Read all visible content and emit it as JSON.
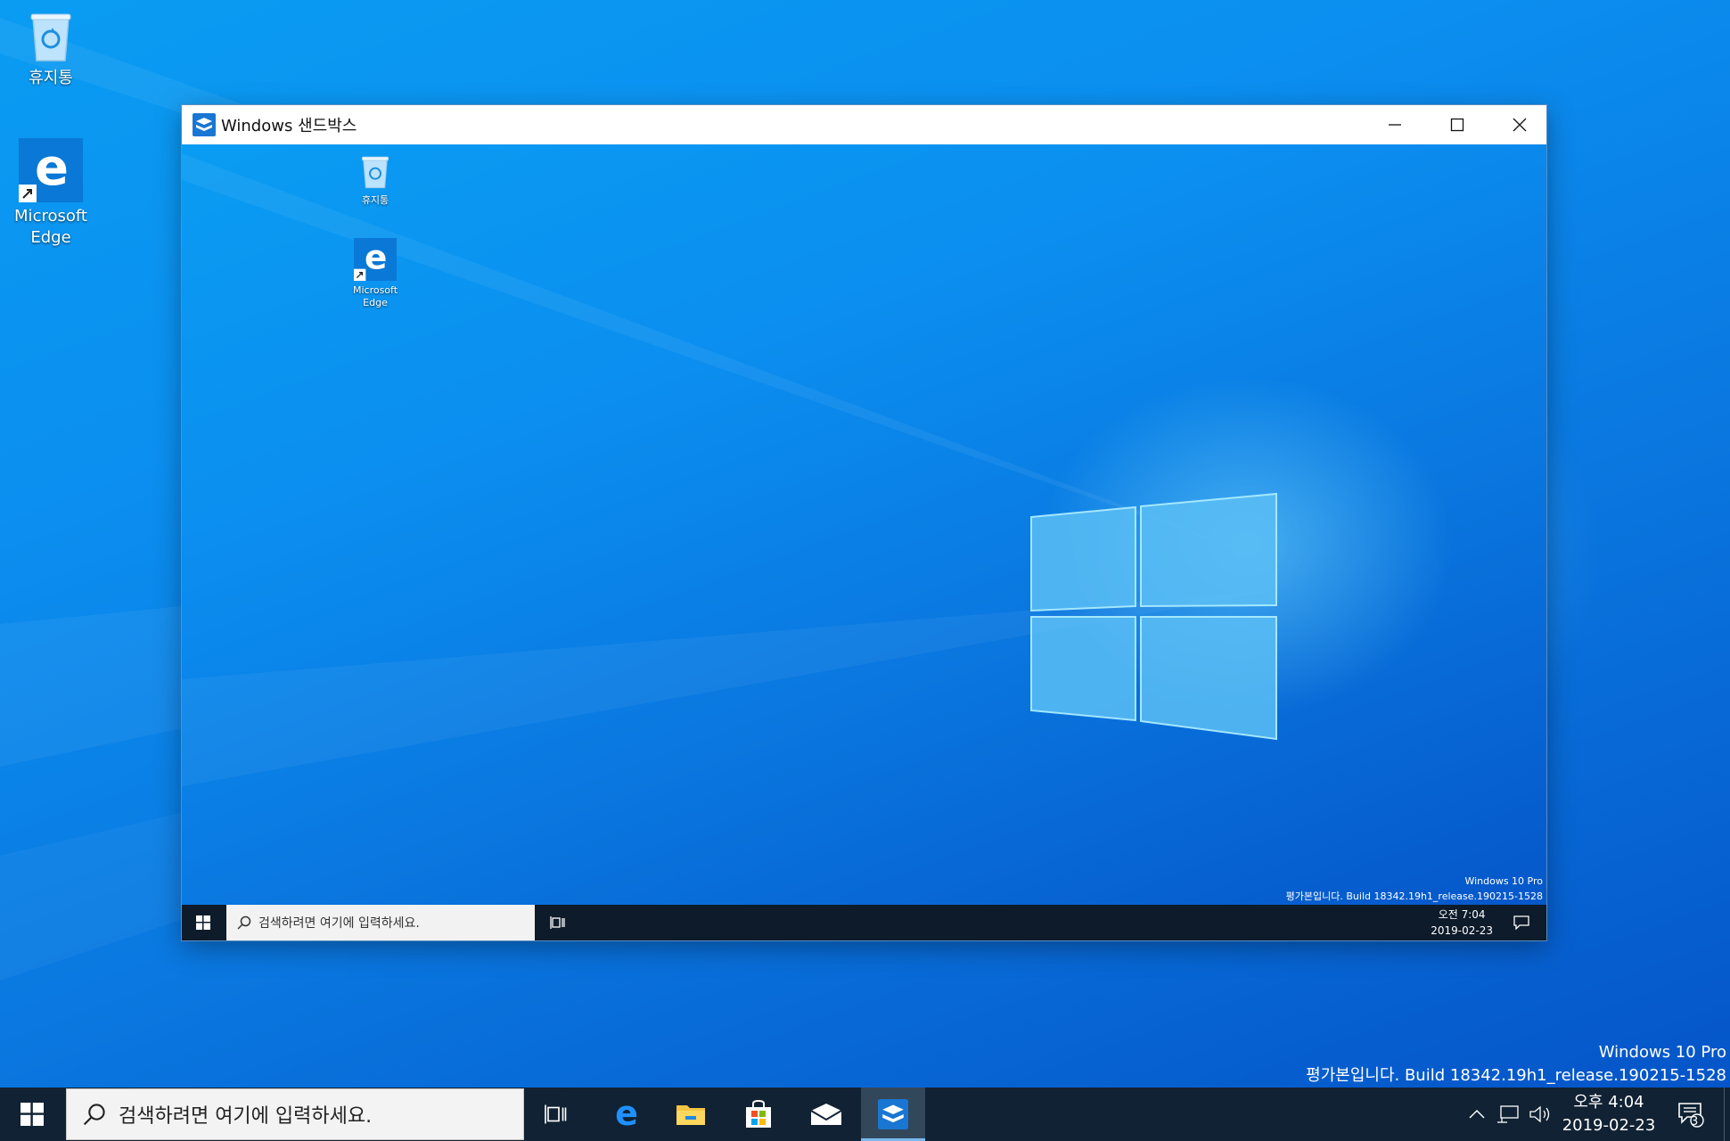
{
  "desktop": {
    "icons": [
      {
        "label": "휴지통",
        "icon": "recycle-bin-icon"
      },
      {
        "label": "Microsoft Edge",
        "icon": "edge-icon"
      }
    ],
    "watermark": {
      "line1": "Windows 10 Pro",
      "line2": "평가본입니다. Build 18342.19h1_release.190215-1528"
    }
  },
  "window": {
    "title": "Windows 샌드박스",
    "controls": [
      "minimize-icon",
      "maximize-icon",
      "close-icon"
    ]
  },
  "sandbox": {
    "icons": [
      {
        "label": "휴지통",
        "icon": "recycle-bin-icon"
      },
      {
        "label": "Microsoft Edge",
        "icon": "edge-icon"
      }
    ],
    "watermark": {
      "line1": "Windows 10 Pro",
      "line2": "평가본입니다. Build 18342.19h1_release.190215-1528"
    },
    "taskbar": {
      "search_placeholder": "검색하려면 여기에 입력하세요.",
      "time": "오전 7:04",
      "date": "2019-02-23"
    }
  },
  "taskbar": {
    "search_placeholder": "검색하려면 여기에 입력하세요.",
    "apps": [
      "task-view-icon",
      "edge-icon",
      "file-explorer-icon",
      "store-icon",
      "mail-icon",
      "sandbox-icon"
    ],
    "time": "오후 4:04",
    "date": "2019-02-23",
    "notification_count": "3"
  },
  "colors": {
    "accent": "#0078d7",
    "taskbar": "#102233",
    "inner_taskbar": "#0d1b2a"
  }
}
